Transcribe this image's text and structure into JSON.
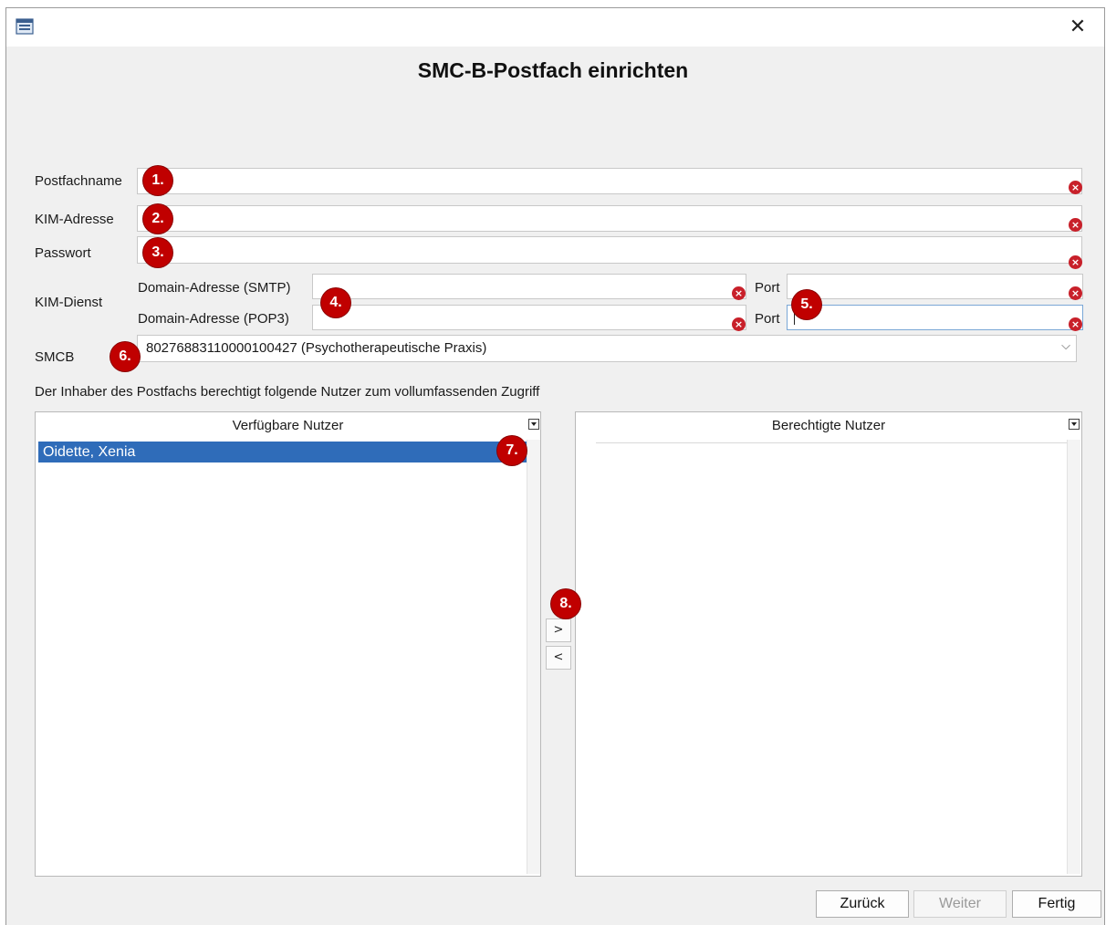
{
  "window": {
    "close_glyph": "✕",
    "app_icon": "window-list-icon"
  },
  "heading": "SMC-B-Postfach einrichten",
  "fields": {
    "postfachname": {
      "label": "Postfachname",
      "value": ""
    },
    "kim_adresse": {
      "label": "KIM-Adresse",
      "value": ""
    },
    "passwort": {
      "label": "Passwort",
      "value": ""
    }
  },
  "kim_dienst": {
    "label": "KIM-Dienst",
    "smtp_label": "Domain-Adresse (SMTP)",
    "pop3_label": "Domain-Adresse (POP3)",
    "port_label": "Port"
  },
  "smcb": {
    "label": "SMCB",
    "selected": "80276883110000100427 (Psychotherapeutische Praxis)",
    "chevron": "⌵"
  },
  "permission_text": "Der Inhaber des Postfachs berechtigt folgende Nutzer zum vollumfassenden Zugriff",
  "available_users": {
    "header": "Verfügbare Nutzer",
    "items": [
      "Oidette, Xenia"
    ]
  },
  "authorized_users": {
    "header": "Berechtigte Nutzer",
    "items": []
  },
  "move_buttons": {
    "add": ">",
    "remove": "<"
  },
  "badges": [
    "1.",
    "2.",
    "3.",
    "4.",
    "5.",
    "6.",
    "7.",
    "8."
  ],
  "footer": {
    "back": "Zurück",
    "next": "Weiter",
    "finish": "Fertig"
  },
  "colors": {
    "badge": "#c00000",
    "selection": "#2f6cb9",
    "clear_icon": "#c8202a"
  }
}
